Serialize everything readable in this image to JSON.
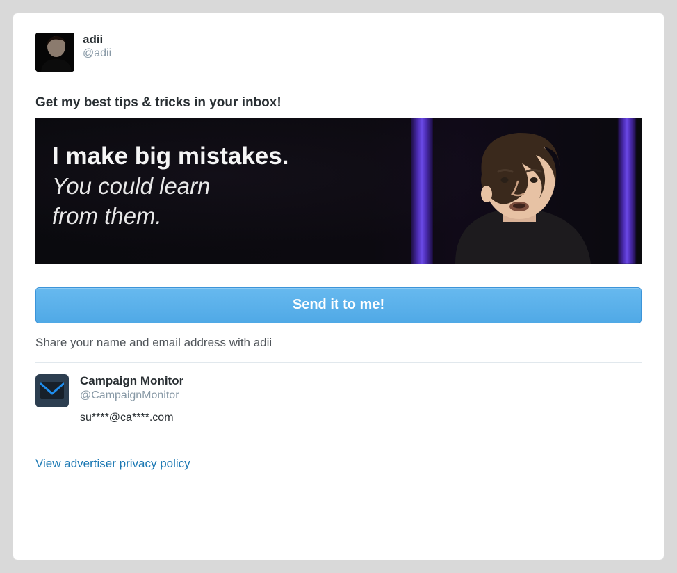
{
  "profile": {
    "display_name": "adii",
    "handle": "@adii"
  },
  "heading": "Get my best tips & tricks in your inbox!",
  "hero": {
    "line1": "I make big mistakes.",
    "line2_a": "You could learn",
    "line2_b": "from them."
  },
  "cta": {
    "label": "Send it to me!"
  },
  "share_text": "Share your name and email address with adii",
  "org": {
    "name": "Campaign Monitor",
    "handle": "@CampaignMonitor",
    "email_masked": "su****@ca****.com"
  },
  "privacy_link": "View advertiser privacy policy",
  "colors": {
    "button_bg": "#55acee",
    "link": "#1b78b3",
    "muted": "#8899a6"
  }
}
